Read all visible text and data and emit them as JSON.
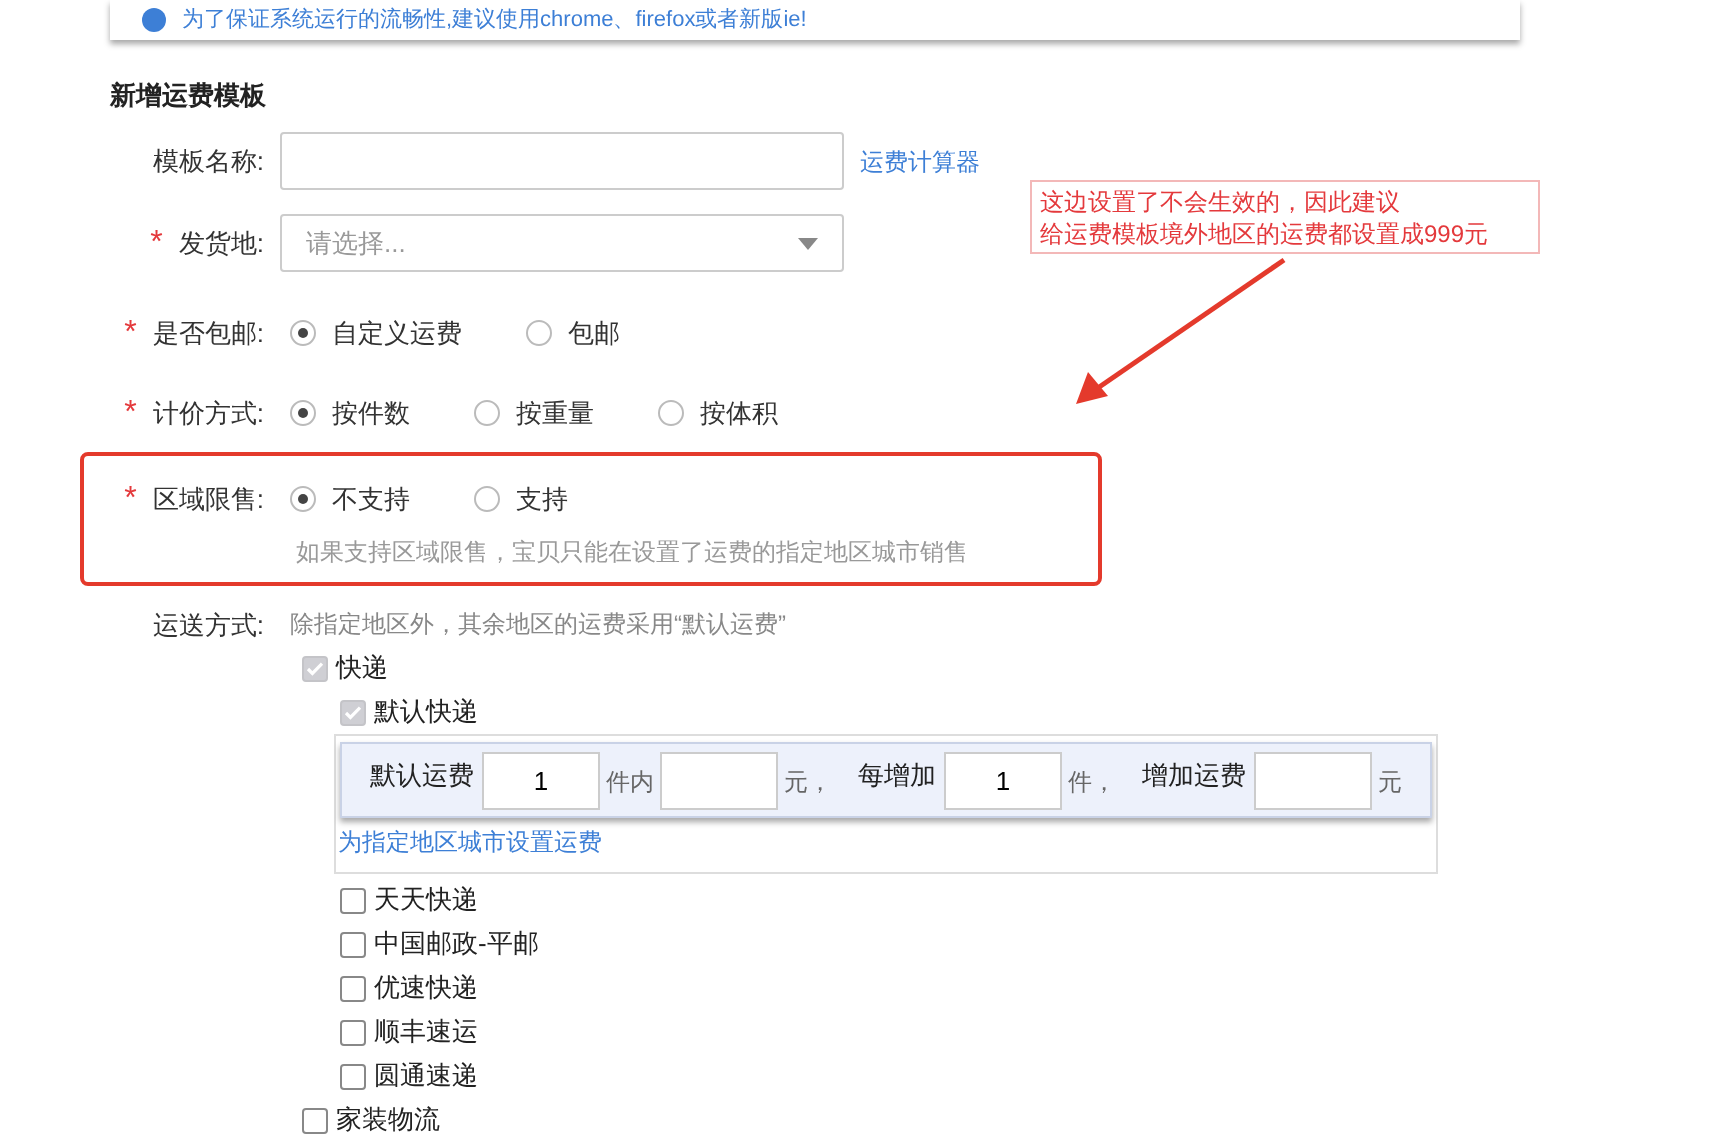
{
  "notice": {
    "text": "为了保证系统运行的流畅性,建议使用chrome、firefox或者新版ie!"
  },
  "title": "新增运费模板",
  "name_field": {
    "label": "模板名称:",
    "link": "运费计算器"
  },
  "origin_field": {
    "label": "发货地:",
    "required_mark": "*",
    "placeholder": "请选择..."
  },
  "radio_groups": [
    {
      "label": "是否包邮:",
      "required_mark": "*",
      "highlighted": false,
      "options": [
        {
          "label": "自定义运费",
          "selected": true
        },
        {
          "label": "包邮",
          "selected": false
        }
      ]
    },
    {
      "label": "计价方式:",
      "required_mark": "*",
      "highlighted": false,
      "options": [
        {
          "label": "按件数",
          "selected": true
        },
        {
          "label": "按重量",
          "selected": false
        },
        {
          "label": "按体积",
          "selected": false
        }
      ]
    },
    {
      "label": "区域限售:",
      "required_mark": "*",
      "highlighted": true,
      "hint": "如果支持区域限售，宝贝只能在设置了运费的指定地区城市销售",
      "options": [
        {
          "label": "不支持",
          "selected": true
        },
        {
          "label": "支持",
          "selected": false
        }
      ]
    }
  ],
  "shipping": {
    "label": "运送方式:",
    "note": "除指定地区外，其余地区的运费采用“默认运费”",
    "methods": [
      {
        "label": "快递",
        "checked": true,
        "children": [
          {
            "label": "默认快递",
            "checked": true,
            "fee": [
              {
                "kind": "label",
                "text": "默认运费"
              },
              {
                "kind": "input",
                "value": "1"
              },
              {
                "kind": "unit",
                "text": "件内"
              },
              {
                "kind": "input"
              },
              {
                "kind": "unit",
                "text": "元，"
              },
              {
                "kind": "label",
                "text": "每增加"
              },
              {
                "kind": "input",
                "value": "1"
              },
              {
                "kind": "unit",
                "text": "件，"
              },
              {
                "kind": "label",
                "text": "增加运费"
              },
              {
                "kind": "input"
              },
              {
                "kind": "unit",
                "text": "元"
              }
            ],
            "link": "为指定地区城市设置运费"
          },
          {
            "label": "天天快递",
            "checked": false
          },
          {
            "label": "中国邮政-平邮",
            "checked": false
          },
          {
            "label": "优速快递",
            "checked": false
          },
          {
            "label": "顺丰速运",
            "checked": false
          },
          {
            "label": "圆通速递",
            "checked": false
          }
        ]
      },
      {
        "label": "家装物流",
        "checked": false
      }
    ]
  },
  "annotation": {
    "lines": [
      "这边设置了不会生效的，因此建议",
      "给运费模板境外地区的运费都设置成999元"
    ]
  }
}
